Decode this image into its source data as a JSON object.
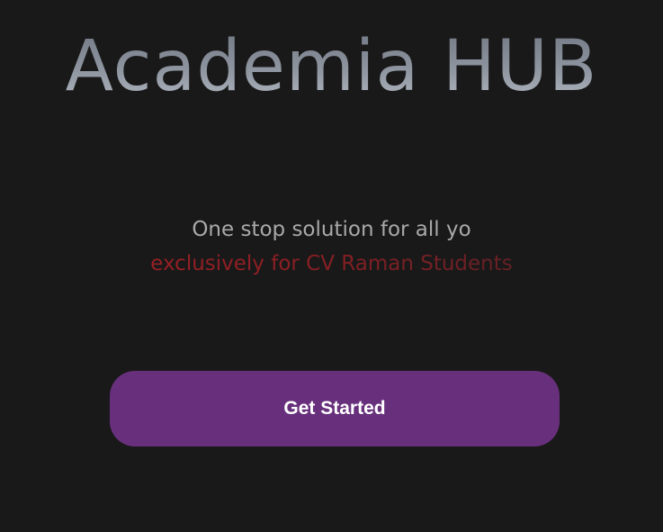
{
  "app": {
    "title": "Academia HUB"
  },
  "hero": {
    "tagline": "One stop solution for all yo",
    "subtagline": "exclusively for CV Raman Students"
  },
  "cta": {
    "label": "Get Started"
  },
  "colors": {
    "background": "#191919",
    "button": "#68307c",
    "accent_red": "#a41f25",
    "tagline_gray": "#a9a9a9"
  }
}
